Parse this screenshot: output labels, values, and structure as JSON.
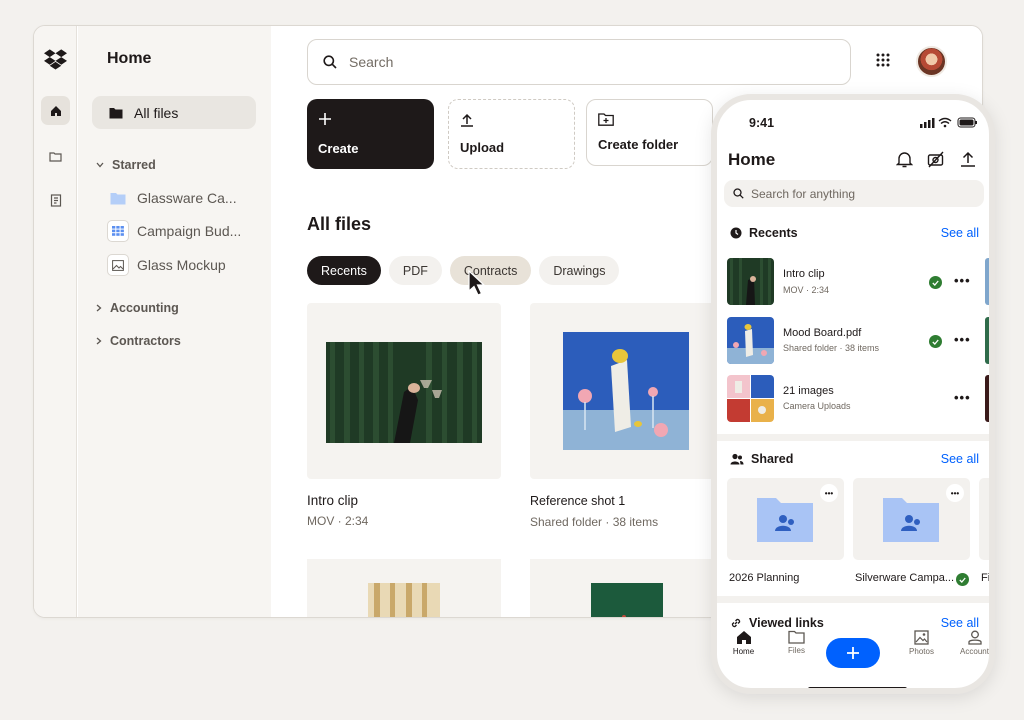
{
  "sidebar": {
    "title": "Home",
    "all_files": "All files",
    "starred_label": "Starred",
    "starred_items": [
      "Glassware Ca...",
      "Campaign Bud...",
      "Glass Mockup"
    ],
    "groups": [
      "Accounting",
      "Contractors"
    ]
  },
  "search": {
    "placeholder": "Search"
  },
  "actions": {
    "create": "Create",
    "upload": "Upload",
    "create_folder": "Create folder"
  },
  "files": {
    "title": "All files",
    "filters": [
      "Recents",
      "PDF",
      "Contracts",
      "Drawings"
    ],
    "active_filter": "Recents",
    "cards": [
      {
        "name": "Intro clip",
        "meta": "MOV · 2:34"
      },
      {
        "name": "Reference shot 1",
        "meta": "Shared folder ·  38 items"
      }
    ]
  },
  "phone": {
    "time": "9:41",
    "title": "Home",
    "search_placeholder": "Search for anything",
    "recents_label": "Recents",
    "see_all": "See all",
    "recents": [
      {
        "name": "Intro clip",
        "meta": "MOV · 2:34",
        "synced": true
      },
      {
        "name": "Mood Board.pdf",
        "meta": "Shared folder · 38 items",
        "synced": true
      },
      {
        "name": "21 images",
        "meta": "Camera Uploads",
        "synced": false
      }
    ],
    "shared_label": "Shared",
    "shared": [
      "2026 Planning",
      "Silverware Campa...",
      "Fi"
    ],
    "viewed_links_label": "Viewed links",
    "nav": [
      "Home",
      "Files",
      "Photos",
      "Account"
    ],
    "colors": {
      "accent": "#0061fe",
      "synced": "#2f7d32"
    }
  }
}
